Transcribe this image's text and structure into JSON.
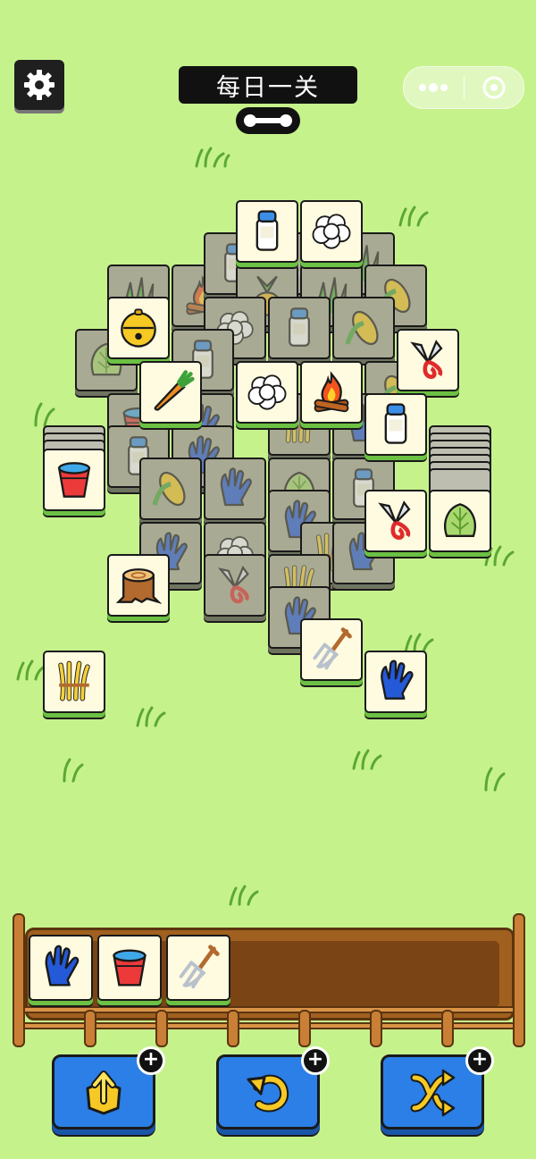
{
  "header": {
    "title": "每日一关",
    "menu_more_icon": "more-dots-icon",
    "menu_close_icon": "target-circle-icon"
  },
  "colors": {
    "background": "#c6f28c",
    "tile_face": "#fffbe0",
    "tile_dim": "#a9aa93",
    "tray_wood": "#a0601f",
    "tool_button": "#2b7fe6"
  },
  "tray": {
    "capacity": 7,
    "items": [
      "glove",
      "bucket",
      "pitchfork"
    ]
  },
  "toolbar": {
    "buttons": [
      {
        "name": "move-out",
        "icon": "move-out-icon",
        "badge": "+"
      },
      {
        "name": "undo",
        "icon": "undo-icon",
        "badge": "+"
      },
      {
        "name": "shuffle",
        "icon": "shuffle-icon",
        "badge": "+"
      }
    ]
  }
}
